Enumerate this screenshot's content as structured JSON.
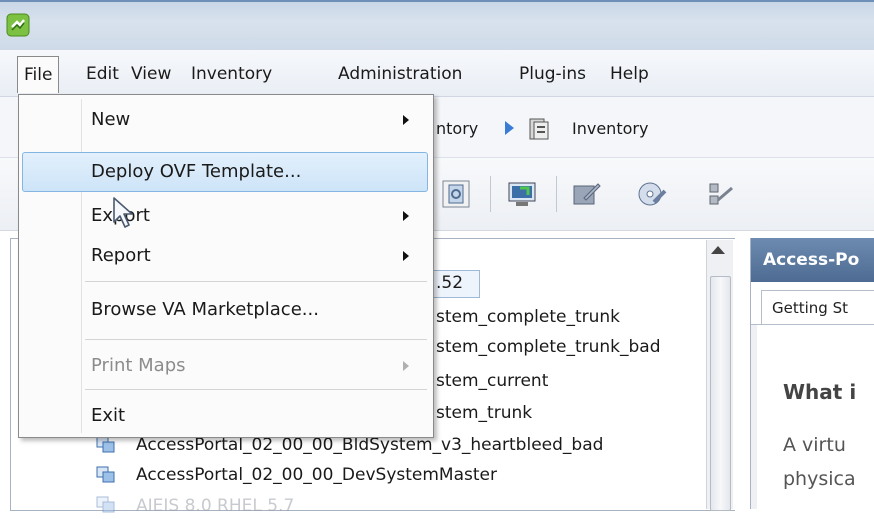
{
  "menubar": {
    "items": [
      "File",
      "Edit",
      "View",
      "Inventory",
      "Administration",
      "Plug-ins",
      "Help"
    ]
  },
  "navbar": {
    "crumb_partial": "ntory",
    "crumb_current": "Inventory"
  },
  "file_menu": {
    "items": [
      {
        "label": "New",
        "submenu": true,
        "enabled": true
      },
      {
        "label": "Deploy OVF Template...",
        "submenu": false,
        "enabled": true,
        "highlighted": true
      },
      {
        "label": "Export",
        "submenu": true,
        "enabled": true
      },
      {
        "label": "Report",
        "submenu": true,
        "enabled": true
      },
      {
        "label": "Browse VA Marketplace...",
        "submenu": false,
        "enabled": true
      },
      {
        "label": "Print Maps",
        "submenu": true,
        "enabled": false
      },
      {
        "label": "Exit",
        "submenu": false,
        "enabled": true
      }
    ]
  },
  "tree": {
    "rows": [
      ".52",
      "stem_complete_trunk",
      "stem_complete_trunk_bad",
      "stem_current",
      "stem_trunk",
      "AccessPortal_02_00_00_BldSystem_v3_heartbleed_bad",
      "AccessPortal_02_00_00_DevSystemMaster",
      "AIEIS 8.0 RHEL 5.7"
    ]
  },
  "right_pane": {
    "header": "Access-Po",
    "tab": "Getting St",
    "heading": "What i",
    "text_line1": "A virtu",
    "text_line2": "physica"
  },
  "colors": {
    "highlight": "#cde4f8",
    "pane_header": "#5a7aa3",
    "nav_arrow": "#3a7bd5"
  }
}
